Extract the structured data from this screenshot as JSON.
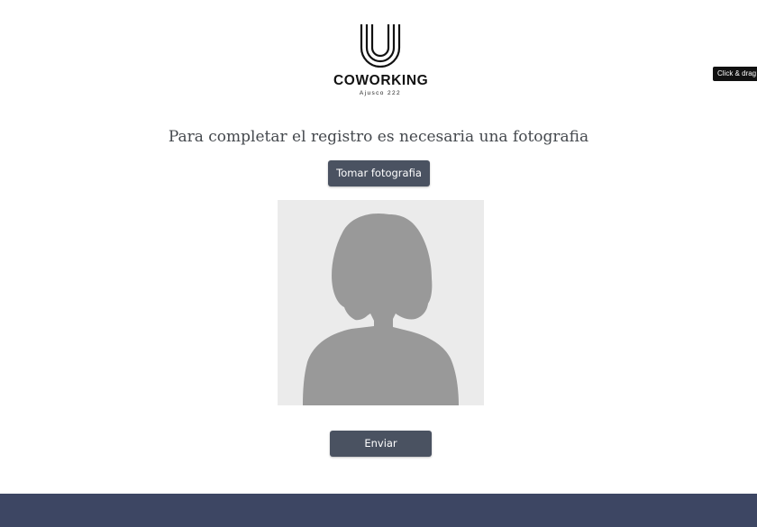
{
  "logo": {
    "wordmark": "COWORKING",
    "subtitle": "Ajusco 222",
    "icon": "u-lines-logo-icon"
  },
  "drag_tooltip": "Click & drag",
  "heading": "Para completar el registro es necesaria una fotografia",
  "take_photo_button": "Tomar fotografia",
  "photo_placeholder": {
    "icon": "avatar-silhouette-icon"
  },
  "send_button": "Enviar",
  "colors": {
    "button": "#4a5261",
    "footer": "#3d4663",
    "placeholder_bg": "#ebebeb",
    "silhouette": "#999999"
  }
}
